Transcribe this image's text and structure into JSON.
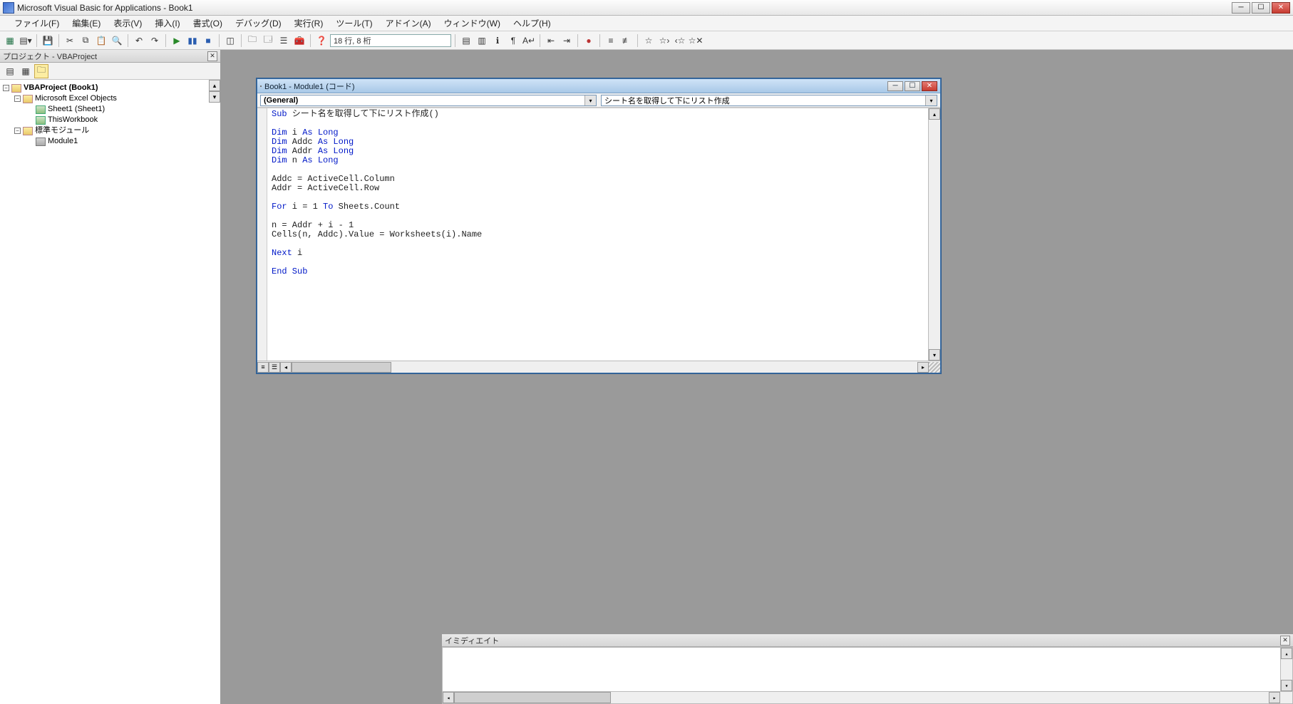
{
  "app": {
    "title": "Microsoft Visual Basic for Applications - Book1"
  },
  "menus": {
    "file": "ファイル(F)",
    "edit": "編集(E)",
    "view": "表示(V)",
    "insert": "挿入(I)",
    "format": "書式(O)",
    "debug": "デバッグ(D)",
    "run": "実行(R)",
    "tools": "ツール(T)",
    "addins": "アドイン(A)",
    "window": "ウィンドウ(W)",
    "help": "ヘルプ(H)"
  },
  "toolbar": {
    "position": "18 行, 8 桁"
  },
  "project_pane": {
    "title": "プロジェクト - VBAProject",
    "root": "VBAProject (Book1)",
    "excel_objects": "Microsoft Excel Objects",
    "sheet1": "Sheet1 (Sheet1)",
    "thisworkbook": "ThisWorkbook",
    "std_modules": "標準モジュール",
    "module1": "Module1"
  },
  "code_window": {
    "title": "Book1 - Module1 (コード)",
    "object_dd": "(General)",
    "proc_dd": "シート名を取得して下にリスト作成"
  },
  "code": {
    "l1_a": "Sub",
    "l1_b": " シート名を取得して下にリスト作成()",
    "l2": "",
    "l3_a": "Dim",
    "l3_b": " i ",
    "l3_c": "As Long",
    "l4_a": "Dim",
    "l4_b": " Addc ",
    "l4_c": "As Long",
    "l5_a": "Dim",
    "l5_b": " Addr ",
    "l5_c": "As Long",
    "l6_a": "Dim",
    "l6_b": " n ",
    "l6_c": "As Long",
    "l7": "",
    "l8": "Addc = ActiveCell.Column",
    "l9": "Addr = ActiveCell.Row",
    "l10": "",
    "l11_a": "For",
    "l11_b": " i = 1 ",
    "l11_c": "To",
    "l11_d": " Sheets.Count",
    "l12": "",
    "l13": "n = Addr + i - 1",
    "l14": "Cells(n, Addc).Value = Worksheets(i).Name",
    "l15": "",
    "l16_a": "Next",
    "l16_b": " i",
    "l17": "",
    "l18_a": "End Sub"
  },
  "immediate": {
    "title": "イミディエイト"
  }
}
